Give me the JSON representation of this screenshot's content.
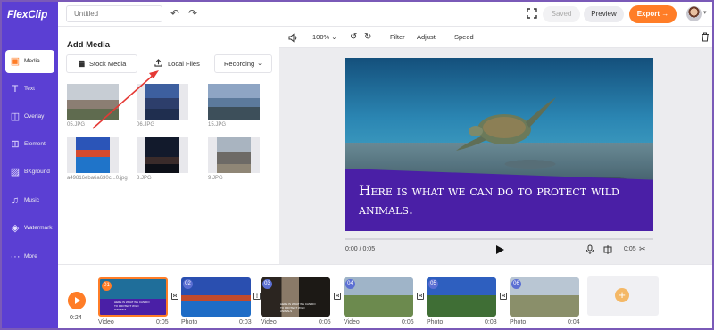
{
  "app": {
    "logo": "FlexClip",
    "title_placeholder": "Untitled",
    "saved_label": "Saved",
    "preview_label": "Preview",
    "export_label": "Export →"
  },
  "sidebar": {
    "items": [
      {
        "label": "Media",
        "icon": "media-icon"
      },
      {
        "label": "Text",
        "icon": "text-icon"
      },
      {
        "label": "Overlay",
        "icon": "overlay-icon"
      },
      {
        "label": "Element",
        "icon": "element-icon"
      },
      {
        "label": "BKground",
        "icon": "background-icon"
      },
      {
        "label": "Music",
        "icon": "music-icon"
      },
      {
        "label": "Watermark",
        "icon": "watermark-icon"
      },
      {
        "label": "More",
        "icon": "more-icon"
      }
    ]
  },
  "media": {
    "title": "Add Media",
    "tabs": {
      "stock": "Stock Media",
      "local": "Local Files",
      "recording": "Recording"
    },
    "files": [
      {
        "name": "05.JPG"
      },
      {
        "name": "06.JPG"
      },
      {
        "name": "15.JPG"
      },
      {
        "name": "a49816eba6a630c...0.jpg"
      },
      {
        "name": "8.JPG"
      },
      {
        "name": "9.JPG"
      }
    ]
  },
  "toolbar": {
    "zoom": "100%",
    "filter": "Filter",
    "adjust": "Adjust",
    "speed": "Speed"
  },
  "player": {
    "caption": "Here is what we can do to protect wild animals.",
    "time": "0:00 / 0:05",
    "duration": "0:05"
  },
  "timeline": {
    "current_time": "0:24",
    "clips": [
      {
        "num": "01",
        "type": "Video",
        "duration": "0:05",
        "subtitle": "HERE IS WHAT WE CAN DO TO PROTECT WILD ANIMALS"
      },
      {
        "num": "02",
        "type": "Photo",
        "duration": "0:03"
      },
      {
        "num": "03",
        "type": "Video",
        "duration": "0:05",
        "subtitle": "HERE IS WHAT WE CAN DO TO PROTECT WILD ANIMALS"
      },
      {
        "num": "04",
        "type": "Video",
        "duration": "0:06"
      },
      {
        "num": "05",
        "type": "Photo",
        "duration": "0:03"
      },
      {
        "num": "06",
        "type": "Photo",
        "duration": "0:04"
      }
    ]
  },
  "colors": {
    "brand_purple": "#5b3fd3",
    "accent_orange": "#ff7d27",
    "annotation_arrow": "#e53935"
  }
}
